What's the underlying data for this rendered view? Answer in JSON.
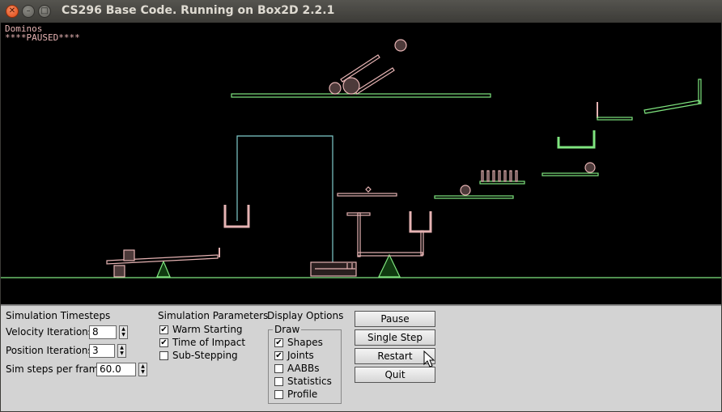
{
  "window": {
    "title": "CS296 Base Code. Running on Box2D 2.2.1",
    "close_glyph": "✕",
    "minimize_glyph": "–",
    "maximize_glyph": "□"
  },
  "canvas": {
    "test_name": "Dominos",
    "paused_text": "****PAUSED****"
  },
  "panel": {
    "timesteps": {
      "heading": "Simulation Timesteps",
      "velocity_label": "Velocity Iterations",
      "velocity_value": "8",
      "position_label": "Position Iterations",
      "position_value": "3",
      "steps_label": "Sim steps per frame",
      "steps_value": "60.0"
    },
    "parameters": {
      "heading": "Simulation Parameters",
      "warm_starting": {
        "label": "Warm Starting",
        "checked": "✔"
      },
      "time_of_impact": {
        "label": "Time of Impact",
        "checked": "✔"
      },
      "sub_stepping": {
        "label": "Sub-Stepping",
        "checked": ""
      }
    },
    "display": {
      "heading": "Display Options",
      "group_label": "Draw",
      "shapes": {
        "label": "Shapes",
        "checked": "✔"
      },
      "joints": {
        "label": "Joints",
        "checked": "✔"
      },
      "aabbs": {
        "label": "AABBs",
        "checked": ""
      },
      "statistics": {
        "label": "Statistics",
        "checked": ""
      },
      "profile": {
        "label": "Profile",
        "checked": ""
      }
    },
    "buttons": {
      "pause": "Pause",
      "single_step": "Single Step",
      "restart": "Restart",
      "quit": "Quit"
    }
  },
  "colors": {
    "static_body": "#7fe57f",
    "dynamic_body": "#e6b3b3",
    "joint": "#80cccc",
    "panel_bg": "#d3d3d3"
  }
}
